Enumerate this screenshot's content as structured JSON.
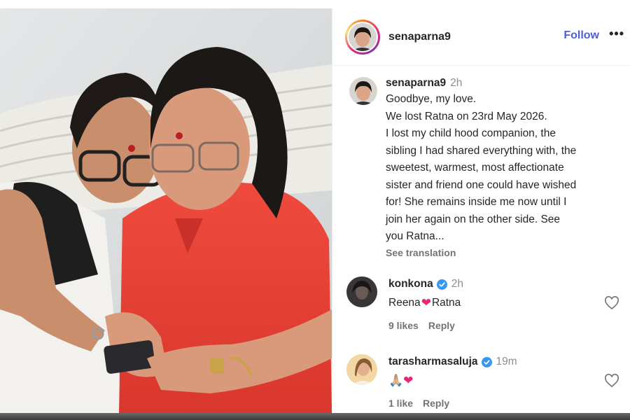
{
  "post": {
    "username": "senaparna9",
    "follow_label": "Follow",
    "more_label": "•••"
  },
  "caption": {
    "username": "senaparna9",
    "time": "2h",
    "lines": [
      "Goodbye, my love.",
      "We lost Ratna on 23rd May 2026.",
      "I lost my child hood companion, the",
      "sibling I had shared everything with, the",
      "sweetest, warmest, most affectionate",
      "sister and friend one could have wished",
      "for! She remains inside me now until I",
      "join her again on the other side. See",
      "you Ratna..."
    ],
    "see_translation": "See translation"
  },
  "comments": [
    {
      "username": "konkona",
      "verified": true,
      "time": "2h",
      "text_before": "Reena",
      "emoji": "❤",
      "text_after": "Ratna",
      "likes": "9 likes",
      "reply": "Reply"
    },
    {
      "username": "tarasharmasaluja",
      "verified": true,
      "time": "19m",
      "text_before": "",
      "emoji": "🙏🏼❤",
      "text_after": "",
      "likes": "1 like",
      "reply": "Reply"
    }
  ],
  "colors": {
    "follow": "#4a5fd8",
    "verified": "#3897f0",
    "heart_emoji": "#e8277a",
    "shirt_red": "#e8443a"
  }
}
